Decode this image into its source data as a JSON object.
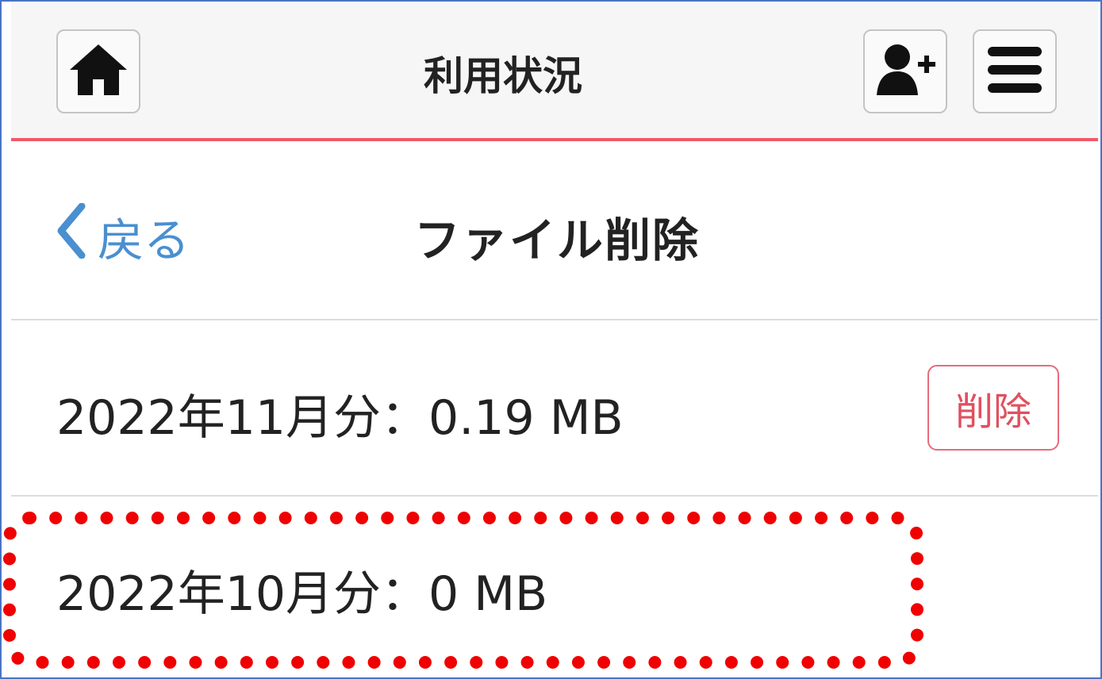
{
  "header": {
    "title": "利用状況",
    "home_icon": "home-icon",
    "add_user_icon": "add-user-icon",
    "menu_icon": "hamburger-menu-icon",
    "accent_color": "#f0596a"
  },
  "nav": {
    "back_label": "戻る",
    "title": "ファイル削除"
  },
  "files": [
    {
      "label": "2022年11月分：0.19 MB",
      "delete_label": "削除"
    },
    {
      "label": "2022年10月分：0 MB"
    }
  ],
  "highlight_color": "#f00000"
}
